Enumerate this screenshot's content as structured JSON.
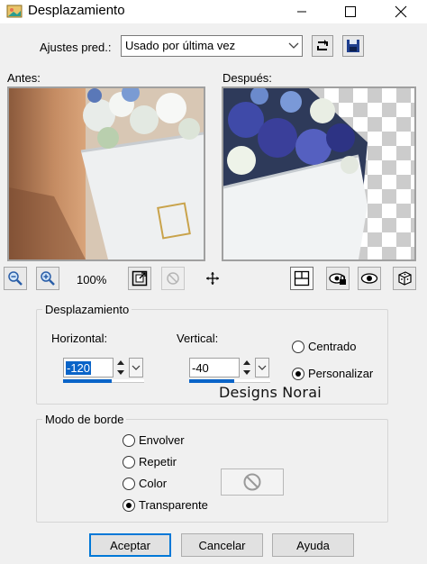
{
  "window": {
    "title": "Desplazamiento",
    "icons": [
      "app-icon",
      "minimize-icon",
      "maximize-icon",
      "close-icon"
    ]
  },
  "presets": {
    "label": "Ajustes pred.:",
    "value": "Usado por última vez",
    "icons": [
      "reset-icon",
      "save-icon"
    ]
  },
  "preview": {
    "before_label": "Antes:",
    "after_label": "Después:"
  },
  "toolbar": {
    "zoom": "100%",
    "icons": [
      "zoom-out-icon",
      "zoom-in-icon",
      "fit-window-icon",
      "no-zoom-icon",
      "pan-icon",
      "proof-icon",
      "preview-lock-icon",
      "eye-icon",
      "randomize-icon"
    ]
  },
  "offset": {
    "group_title": "Desplazamiento",
    "horizontal_label": "Horizontal:",
    "horizontal_value": "-120",
    "horizontal_level": 0.6,
    "vertical_label": "Vertical:",
    "vertical_value": "-40",
    "vertical_level": 0.55,
    "centered_label": "Centrado",
    "custom_label": "Personalizar",
    "selected": "custom"
  },
  "watermark": "Designs Norai",
  "edge_mode": {
    "group_title": "Modo de borde",
    "options": [
      "Envolver",
      "Repetir",
      "Color",
      "Transparente"
    ],
    "selected": "Transparente"
  },
  "buttons": {
    "ok": "Aceptar",
    "cancel": "Cancelar",
    "help": "Ayuda"
  },
  "colors": {
    "accent": "#0a64c8",
    "default_button_border": "#0078d7",
    "dialog_bg": "#f0f0f0"
  }
}
